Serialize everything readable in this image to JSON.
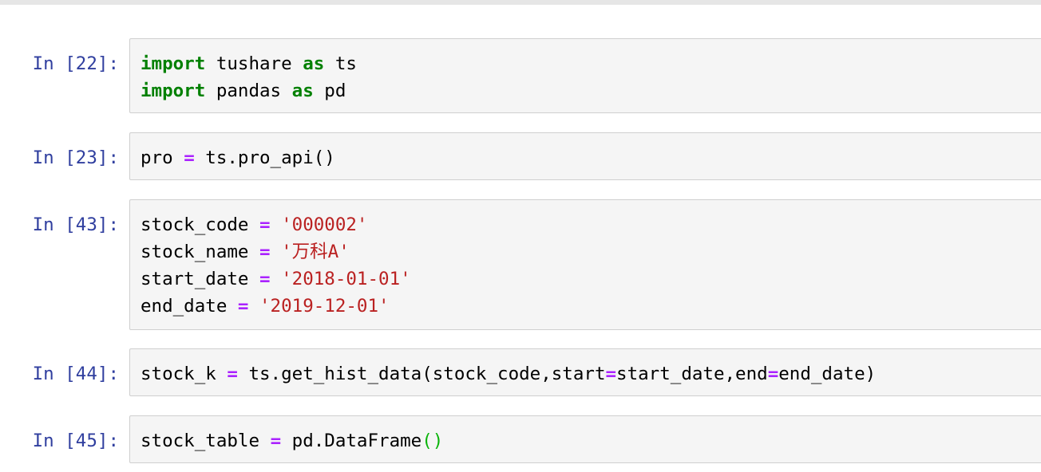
{
  "cells": [
    {
      "prompt": "In [22]:",
      "lines": [
        [
          [
            "kw",
            "import"
          ],
          [
            "t",
            " tushare "
          ],
          [
            "kw",
            "as"
          ],
          [
            "t",
            " ts"
          ]
        ],
        [
          [
            "kw",
            "import"
          ],
          [
            "t",
            " pandas "
          ],
          [
            "kw",
            "as"
          ],
          [
            "t",
            " pd"
          ]
        ]
      ]
    },
    {
      "prompt": "In [23]:",
      "lines": [
        [
          [
            "t",
            "pro "
          ],
          [
            "op",
            "="
          ],
          [
            "t",
            " ts.pro_api()"
          ]
        ]
      ]
    },
    {
      "prompt": "In [43]:",
      "lines": [
        [
          [
            "t",
            "stock_code "
          ],
          [
            "op",
            "="
          ],
          [
            "t",
            " "
          ],
          [
            "str",
            "'000002'"
          ]
        ],
        [
          [
            "t",
            "stock_name "
          ],
          [
            "op",
            "="
          ],
          [
            "t",
            " "
          ],
          [
            "str",
            "'万科A'"
          ]
        ],
        [
          [
            "t",
            "start_date "
          ],
          [
            "op",
            "="
          ],
          [
            "t",
            " "
          ],
          [
            "str",
            "'2018-01-01'"
          ]
        ],
        [
          [
            "t",
            "end_date "
          ],
          [
            "op",
            "="
          ],
          [
            "t",
            " "
          ],
          [
            "str",
            "'2019-12-01'"
          ]
        ]
      ]
    },
    {
      "prompt": "In [44]:",
      "lines": [
        [
          [
            "t",
            "stock_k "
          ],
          [
            "op",
            "="
          ],
          [
            "t",
            " ts.get_hist_data(stock_code,start"
          ],
          [
            "op",
            "="
          ],
          [
            "t",
            "start_date,end"
          ],
          [
            "op",
            "="
          ],
          [
            "t",
            "end_date)"
          ]
        ]
      ]
    },
    {
      "prompt": "In [45]:",
      "lines": [
        [
          [
            "t",
            "stock_table "
          ],
          [
            "op",
            "="
          ],
          [
            "t",
            " pd.DataFrame"
          ],
          [
            "br",
            "()"
          ]
        ]
      ]
    }
  ],
  "colors": {
    "prompt": "#303f9f",
    "keyword": "#008000",
    "operator": "#aa22ff",
    "string": "#ba2121",
    "bracket": "#0ab40a",
    "cell_background": "#f5f5f5",
    "cell_border": "#cfcfcf"
  }
}
